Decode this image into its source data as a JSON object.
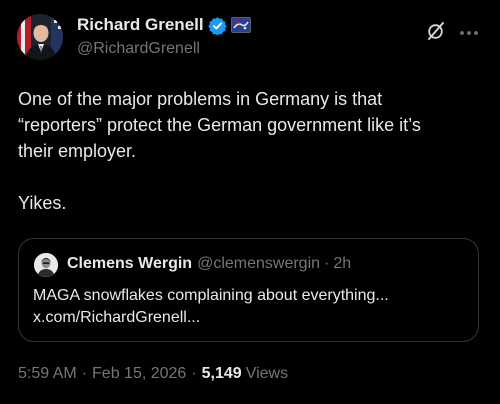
{
  "author": {
    "display_name": "Richard Grenell",
    "handle": "@RichardGrenell",
    "verified": true,
    "affiliate_badge": "flag-badge-icon"
  },
  "actions": {
    "grok_icon": "grok-icon",
    "more_icon": "more-icon"
  },
  "tweet": {
    "text": "One of the major problems in Germany is that\n“reporters” protect the German government like it’s\ntheir employer.\n\nYikes."
  },
  "quoted_tweet": {
    "display_name": "Clemens Wergin",
    "handle": "@clemenswergin",
    "separator": "·",
    "time": "2h",
    "text": "MAGA snowflakes complaining about everything...\nx.com/RichardGrenell..."
  },
  "meta": {
    "time": "5:59 AM",
    "separator": "·",
    "date": "Feb 15, 2026",
    "separator2": "·",
    "views_count": "5,149",
    "views_label": "Views"
  },
  "colors": {
    "background": "#000000",
    "text_primary": "#e7e9ea",
    "text_secondary": "#71767b",
    "verified_blue": "#1d9bf0",
    "border": "#333639"
  }
}
